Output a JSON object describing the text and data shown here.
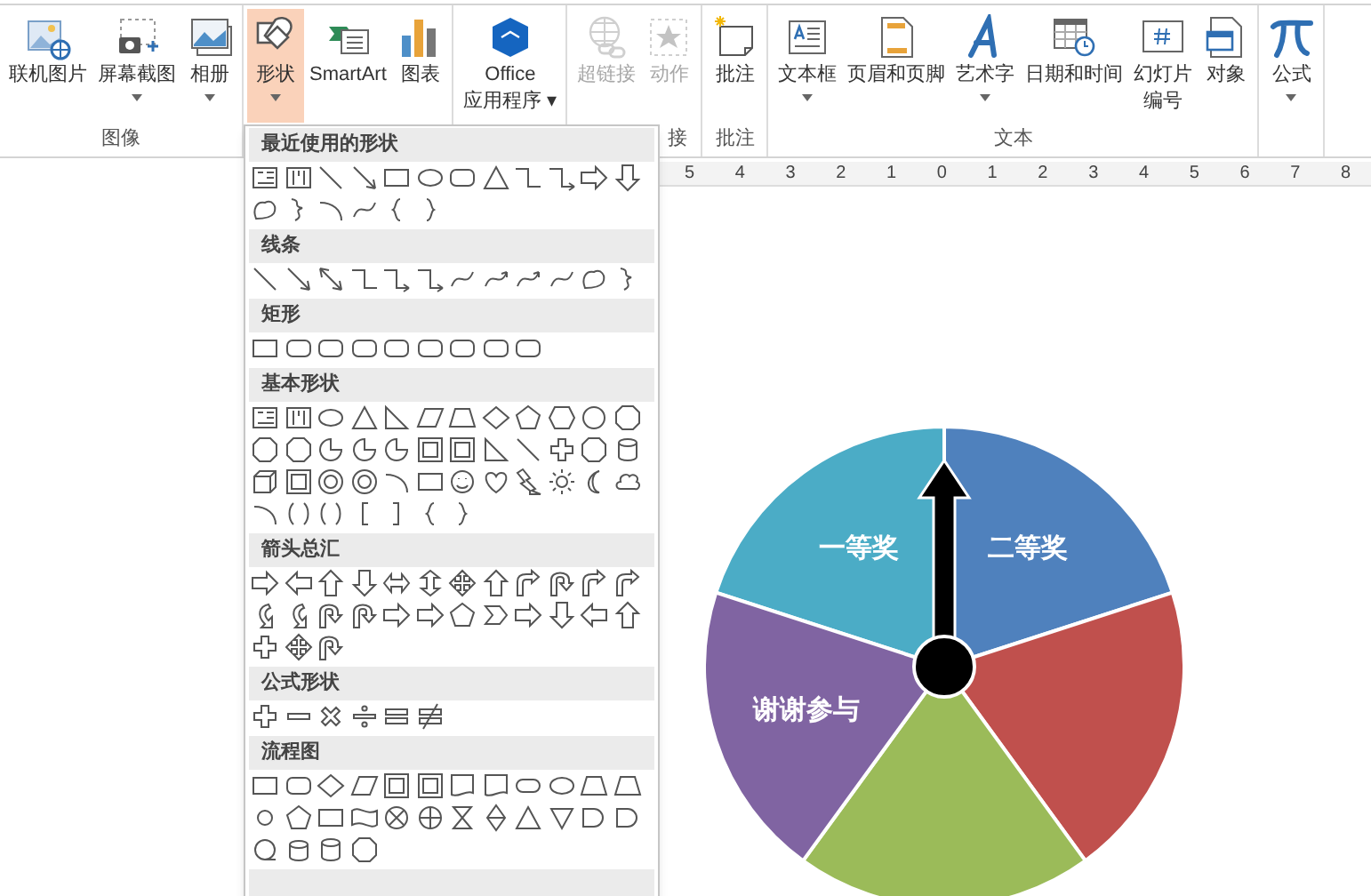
{
  "ribbon": {
    "groups": [
      {
        "label": "图像",
        "buttons": [
          {
            "lines": [
              "联机图片"
            ],
            "dropdown": false,
            "selected": false,
            "disabled": false
          },
          {
            "lines": [
              "屏幕截图"
            ],
            "dropdown": true,
            "selected": false,
            "disabled": false
          },
          {
            "lines": [
              "相册"
            ],
            "dropdown": true,
            "selected": false,
            "disabled": false
          }
        ]
      },
      {
        "buttons": [
          {
            "lines": [
              "形状"
            ],
            "dropdown": true,
            "selected": true,
            "disabled": false
          },
          {
            "lines": [
              "SmartArt"
            ],
            "dropdown": false,
            "selected": false,
            "disabled": false
          },
          {
            "lines": [
              "图表"
            ],
            "dropdown": false,
            "selected": false,
            "disabled": false
          }
        ]
      },
      {
        "buttons": [
          {
            "lines": [
              "Office",
              "应用程序 ▾"
            ],
            "dropdown": false,
            "selected": false,
            "disabled": false
          }
        ]
      },
      {
        "label": "接",
        "buttons": [
          {
            "lines": [
              "超链接"
            ],
            "dropdown": false,
            "selected": false,
            "disabled": true
          },
          {
            "lines": [
              "动作"
            ],
            "dropdown": false,
            "selected": false,
            "disabled": true
          }
        ]
      },
      {
        "label": "批注",
        "buttons": [
          {
            "lines": [
              "批注"
            ],
            "dropdown": false,
            "selected": false,
            "disabled": false
          }
        ]
      },
      {
        "label": "文本",
        "buttons": [
          {
            "lines": [
              "文本框"
            ],
            "dropdown": true,
            "selected": false,
            "disabled": false
          },
          {
            "lines": [
              "页眉和页脚"
            ],
            "dropdown": false,
            "selected": false,
            "disabled": false
          },
          {
            "lines": [
              "艺术字"
            ],
            "dropdown": true,
            "selected": false,
            "disabled": false
          },
          {
            "lines": [
              "日期和时间"
            ],
            "dropdown": false,
            "selected": false,
            "disabled": false
          },
          {
            "lines": [
              "幻灯片",
              "编号"
            ],
            "dropdown": false,
            "selected": false,
            "disabled": false
          },
          {
            "lines": [
              "对象"
            ],
            "dropdown": false,
            "selected": false,
            "disabled": false
          }
        ]
      },
      {
        "buttons": [
          {
            "lines": [
              "公式"
            ],
            "dropdown": true,
            "selected": false,
            "disabled": false
          }
        ]
      }
    ]
  },
  "shapes_menu": {
    "sections": [
      {
        "title": "最近使用的形状"
      },
      {
        "title": "线条"
      },
      {
        "title": "矩形"
      },
      {
        "title": "基本形状"
      },
      {
        "title": "箭头总汇"
      },
      {
        "title": "公式形状"
      },
      {
        "title": "流程图"
      }
    ]
  },
  "ruler": {
    "labels": [
      "5",
      "4",
      "3",
      "2",
      "1",
      "0",
      "1",
      "2",
      "3",
      "4",
      "5",
      "6",
      "7",
      "8"
    ]
  },
  "slide": {
    "wheel": {
      "slices": [
        {
          "label": "一等奖",
          "color": "#4bacc6"
        },
        {
          "label": "二等奖",
          "color": "#4f81bd"
        },
        {
          "color": "#c0504d"
        },
        {
          "color": "#9bbb59"
        },
        {
          "label": "谢谢参与",
          "color": "#8064a2"
        }
      ]
    }
  }
}
